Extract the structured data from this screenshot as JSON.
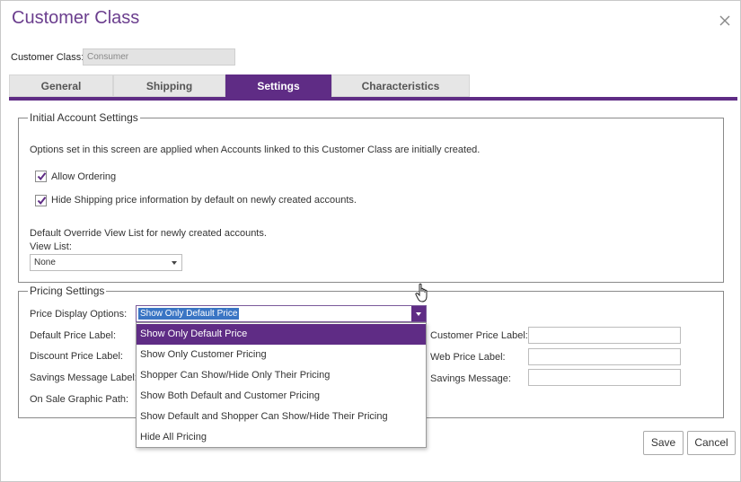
{
  "dialog": {
    "title": "Customer Class"
  },
  "customer_class": {
    "label": "Customer Class:",
    "value": "Consumer"
  },
  "tabs": [
    {
      "label": "General",
      "active": false
    },
    {
      "label": "Shipping",
      "active": false
    },
    {
      "label": "Settings",
      "active": true
    },
    {
      "label": "Characteristics",
      "active": false
    }
  ],
  "initial_account": {
    "legend": "Initial Account Settings",
    "description": "Options set in this screen are applied when Accounts linked to this Customer Class are initially created.",
    "allow_ordering": {
      "label": "Allow Ordering",
      "checked": true
    },
    "hide_shipping": {
      "label": "Hide Shipping price information by default on newly created accounts.",
      "checked": true
    },
    "override_text": "Default Override View List for newly created accounts.",
    "view_list_label": "View List:",
    "view_list_value": "None"
  },
  "pricing": {
    "legend": "Pricing Settings",
    "price_display_label": "Price Display Options:",
    "price_display_value": "Show Only Default Price",
    "default_price_label": "Default Price Label:",
    "discount_price_label": "Discount Price Label:",
    "savings_message_label": "Savings Message Label:",
    "on_sale_graphic_label": "On Sale Graphic Path:",
    "customer_price_label": "Customer Price Label:",
    "web_price_label": "Web Price Label:",
    "savings_message": "Savings Message:",
    "options": [
      "Show Only Default Price",
      "Show Only Customer Pricing",
      "Shopper Can Show/Hide Only Their Pricing",
      "Show Both Default and Customer Pricing",
      "Show Default and Shopper Can Show/Hide Their Pricing",
      "Hide All Pricing"
    ]
  },
  "footer": {
    "save": "Save",
    "cancel": "Cancel"
  },
  "colors": {
    "accent": "#5f2c85",
    "title": "#6b3e8e",
    "selection": "#3a75c4"
  }
}
